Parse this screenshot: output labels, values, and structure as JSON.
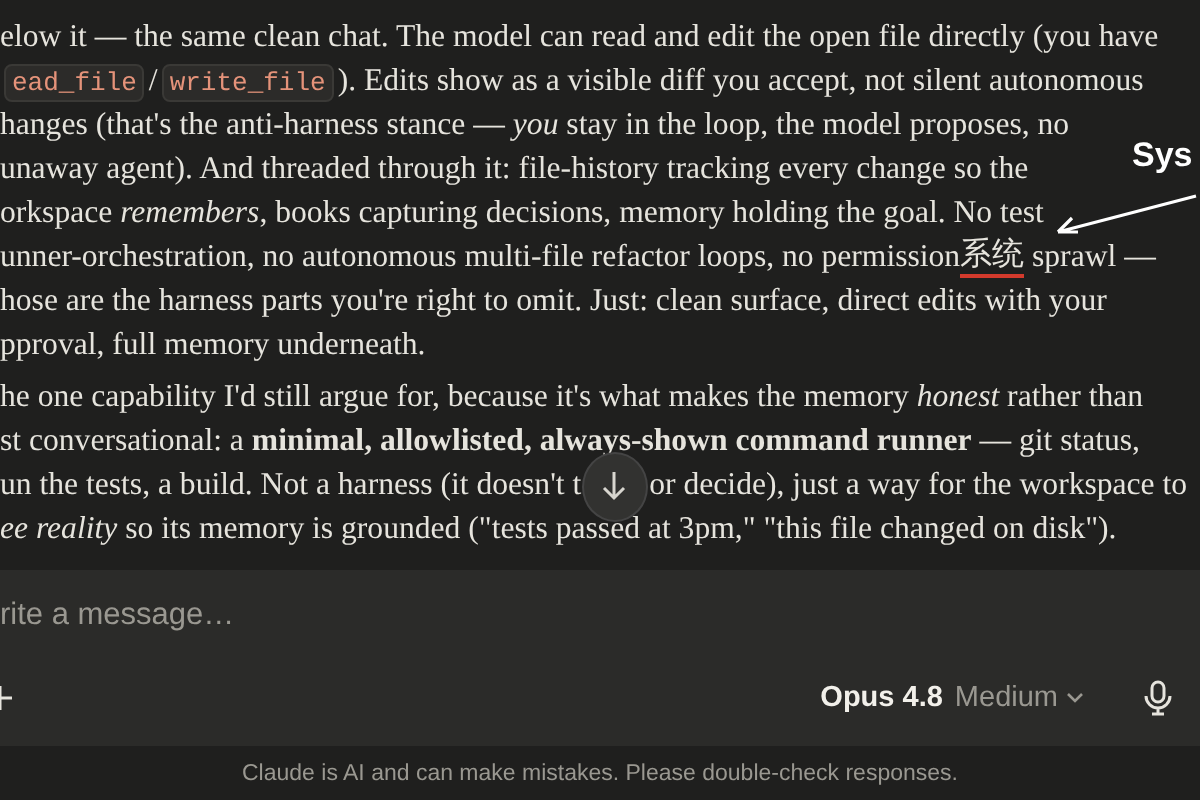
{
  "message": {
    "paragraphs": [
      [
        [
          {
            "kind": "text",
            "text": "elow it — the same clean chat. The model can read and edit the open file directly (you have"
          }
        ],
        [
          {
            "kind": "code",
            "text": "ead_file"
          },
          {
            "kind": "text",
            "text": "/"
          },
          {
            "kind": "code",
            "text": "write_file"
          },
          {
            "kind": "text",
            "text": "). Edits show as a visible diff you accept, not silent autonomous"
          }
        ],
        [
          {
            "kind": "text",
            "text": "hanges (that's the anti-harness stance — *you* stay in the loop, the model proposes, no"
          }
        ],
        [
          {
            "kind": "text",
            "text": "unaway agent). And threaded through it: file-history tracking every change so the"
          }
        ],
        [
          {
            "kind": "text",
            "text": "orkspace *remembers*, books capturing decisions, memory holding the goal. No test"
          }
        ],
        [
          {
            "kind": "text",
            "text": "unner-orchestration, no autonomous multi-file refactor loops, no permission"
          },
          {
            "kind": "underlined",
            "text": "系统"
          },
          {
            "kind": "text",
            "text": " sprawl —"
          }
        ],
        [
          {
            "kind": "text",
            "text": "hose are the harness parts you're right to omit. Just: clean surface, direct edits with your"
          }
        ],
        [
          {
            "kind": "text",
            "text": "pproval, full memory underneath."
          }
        ]
      ],
      [
        [
          {
            "kind": "text",
            "text": "he one capability I'd still argue for, because it's what makes the memory *honest* rather than"
          }
        ],
        [
          {
            "kind": "text",
            "text": "st conversational: a **minimal, allowlisted, always-shown command runner** — git status,"
          }
        ],
        [
          {
            "kind": "text",
            "text": "un the tests, a build. Not a harness (it doesn't t"
          },
          {
            "kind": "gap"
          },
          {
            "kind": "text",
            "text": "or decide), just a way for the workspace to"
          }
        ],
        [
          {
            "kind": "text",
            "text": "*ee reality* so its memory is grounded (\"tests passed at 3pm,\" \"this file changed on disk\")."
          }
        ]
      ]
    ]
  },
  "annotation": {
    "label": "Sys"
  },
  "composer": {
    "placeholder": "rite a message…",
    "model": "Opus 4.8",
    "effort": "Medium"
  },
  "disclaimer": "Claude is AI and can make mistakes. Please double-check responses."
}
